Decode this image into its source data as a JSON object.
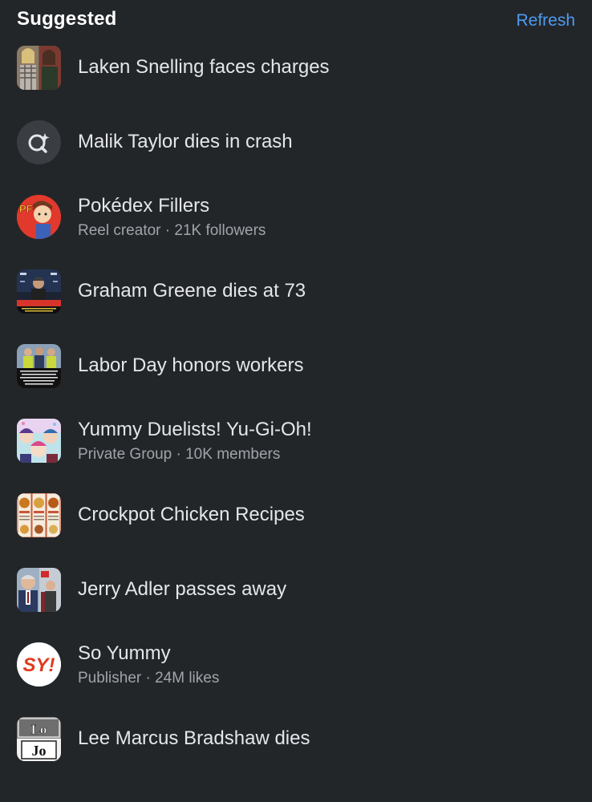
{
  "header": {
    "title": "Suggested",
    "refresh_label": "Refresh"
  },
  "items": [
    {
      "title": "Laken Snelling faces charges",
      "icon": "photo-thumbnail-two-women"
    },
    {
      "title": "Malik Taylor dies in crash",
      "icon": "meta-ai-search-icon"
    },
    {
      "title": "Pokédex Fillers",
      "subtitle": "Reel creator · 21K followers",
      "icon": "pokedex-fillers-avatar",
      "avatar_text": "PF"
    },
    {
      "title": "Graham Greene dies at 73",
      "icon": "photo-thumbnail-man-at-event"
    },
    {
      "title": "Labor Day honors workers",
      "icon": "photo-thumbnail-people-with-caption"
    },
    {
      "title": "Yummy Duelists! Yu-Gi-Oh!",
      "subtitle": "Private Group · 10K members",
      "icon": "group-avatar-anime"
    },
    {
      "title": "Crockpot Chicken Recipes",
      "icon": "photo-thumbnail-recipes"
    },
    {
      "title": "Jerry Adler passes away",
      "icon": "photo-thumbnail-older-man"
    },
    {
      "title": "So Yummy",
      "subtitle": "Publisher · 24M likes",
      "icon": "so-yummy-logo",
      "avatar_text": "SY!"
    },
    {
      "title": "Lee Marcus Bradshaw dies",
      "icon": "photo-thumbnail-lo-jo-logo",
      "avatar_text": "Lo Jo"
    }
  ],
  "colors": {
    "background": "#232629",
    "accent": "#4c9bf2",
    "text_primary": "#e4e6eb",
    "text_secondary": "#a0a4aa",
    "so_yummy_red": "#e03a1e"
  }
}
